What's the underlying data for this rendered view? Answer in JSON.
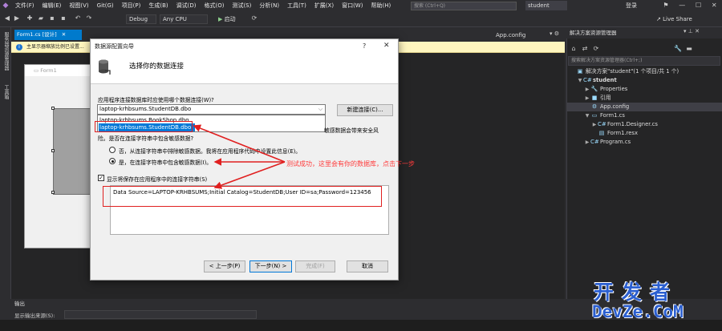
{
  "menubar": {
    "items": [
      "文件(F)",
      "编辑(E)",
      "视图(V)",
      "Git(G)",
      "项目(P)",
      "生成(B)",
      "调试(D)",
      "格式(O)",
      "测试(S)",
      "分析(N)",
      "工具(T)",
      "扩展(X)",
      "窗口(W)",
      "帮助(H)"
    ],
    "search_placeholder": "搜索 (Ctrl+Q)",
    "solution_name": "student",
    "login": "登录"
  },
  "toolbar": {
    "config": "Debug",
    "platform": "Any CPU",
    "start": "启动",
    "live_share": "Live Share"
  },
  "left_strip": {
    "label1": "服务器资源管理器",
    "label2": "工具箱"
  },
  "editor": {
    "doc_tab": "Form1.cs [设计]",
    "app_config_tab": "App.config",
    "info_text": "主显示器缩放比例已设置...",
    "form_title": "Form1"
  },
  "dialog": {
    "title": "数据源配置向导",
    "heading": "选择你的数据连接",
    "question": "应用程序连接数据库时应使用哪个数据连接(W)?",
    "selected_connection": "laptop-krhbsums.StudentDB.dbo",
    "connection_options": [
      "laptop-krhbsums.BookShop.dbo",
      "laptop-krhbsums.StudentDB.dbo"
    ],
    "new_connection_button": "新建连接(C)...",
    "warning_tail": "敏感数据会带来安全风",
    "warning_line2": "险。是否在连接字符串中包含敏感数据?",
    "radio_no": "否，从连接字符串中排除敏感数据。我将在应用程序代码中设置此信息(E)。",
    "radio_yes": "是，在连接字符串中包含敏感数据(I)。",
    "show_conn_string": "显示将保存在应用程序中的连接字符串(S)",
    "connection_string": "Data Source=LAPTOP-KRHBSUMS;Initial Catalog=StudentDB;User ID=sa;Password=123456",
    "annotation": "测试成功，这里会有你的数据库，点击下一步",
    "buttons": {
      "prev": "< 上一步(P)",
      "next": "下一步(N) >",
      "finish": "完成(F)",
      "cancel": "取消"
    }
  },
  "solution_explorer": {
    "title": "解决方案资源管理器",
    "search_placeholder": "搜索解决方案资源管理器(Ctrl+;)",
    "tree": [
      {
        "label": "解决方案\"student\"(1 个项目/共 1 个)",
        "icon": "solution-icon",
        "glyph": "▣",
        "indent": 0,
        "arrow": ""
      },
      {
        "label": "student",
        "icon": "csharp-project-icon",
        "glyph": "C#",
        "indent": 1,
        "arrow": "▼"
      },
      {
        "label": "Properties",
        "icon": "wrench-icon",
        "glyph": "🔧",
        "indent": 2,
        "arrow": "▶"
      },
      {
        "label": "引用",
        "icon": "references-icon",
        "glyph": "■",
        "indent": 2,
        "arrow": "▶"
      },
      {
        "label": "App.config",
        "icon": "config-file-icon",
        "glyph": "⚙",
        "indent": 2,
        "arrow": "",
        "selected": true
      },
      {
        "label": "Form1.cs",
        "icon": "form-icon",
        "glyph": "▭",
        "indent": 2,
        "arrow": "▼"
      },
      {
        "label": "Form1.Designer.cs",
        "icon": "csharp-file-icon",
        "glyph": "C#",
        "indent": 3,
        "arrow": "▶"
      },
      {
        "label": "Form1.resx",
        "icon": "resx-file-icon",
        "glyph": "▤",
        "indent": 3,
        "arrow": ""
      },
      {
        "label": "Program.cs",
        "icon": "csharp-file-icon",
        "glyph": "C#",
        "indent": 2,
        "arrow": "▶"
      }
    ]
  },
  "output": {
    "title": "输出",
    "source_label": "显示输出来源(S):"
  },
  "watermark": {
    "cn": "开发者",
    "en": "DevZe.CoM"
  },
  "colors": {
    "accent": "#007acc",
    "annotation_red": "#e02020",
    "selection_blue": "#0078d7"
  }
}
